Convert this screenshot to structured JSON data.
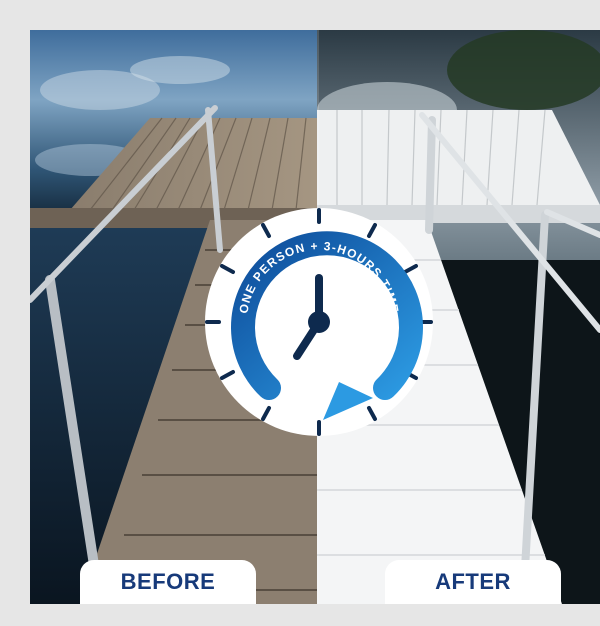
{
  "labels": {
    "before": "BEFORE",
    "after": "AFTER"
  },
  "badge": {
    "text": "ONE PERSON + 3-HOURS TIME"
  },
  "colors": {
    "brand_blue": "#1f78c8",
    "label_text": "#173a7a",
    "light_blue": "#63b4ec"
  },
  "icons": {
    "clock": "clock-icon",
    "arrow": "circular-arrow-icon"
  }
}
